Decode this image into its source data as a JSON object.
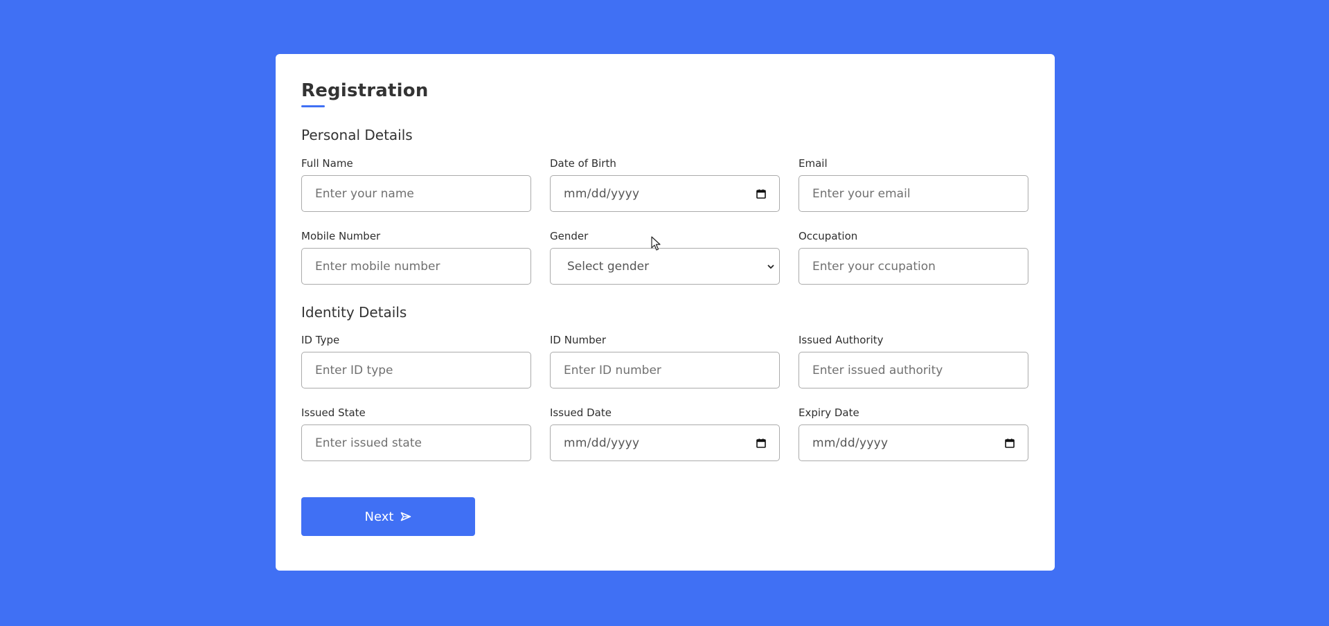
{
  "form": {
    "title": "Registration",
    "next_label": "Next"
  },
  "sections": {
    "personal": {
      "title": "Personal Details",
      "full_name": {
        "label": "Full Name",
        "placeholder": "Enter your name"
      },
      "dob": {
        "label": "Date of Birth",
        "value": "mm/dd/yyyy"
      },
      "email": {
        "label": "Email",
        "placeholder": "Enter your email"
      },
      "mobile": {
        "label": "Mobile Number",
        "placeholder": "Enter mobile number"
      },
      "gender": {
        "label": "Gender",
        "selected": "Select gender"
      },
      "occupation": {
        "label": "Occupation",
        "placeholder": "Enter your ccupation"
      }
    },
    "identity": {
      "title": "Identity Details",
      "id_type": {
        "label": "ID Type",
        "placeholder": "Enter ID type"
      },
      "id_number": {
        "label": "ID Number",
        "placeholder": "Enter ID number"
      },
      "issued_authority": {
        "label": "Issued Authority",
        "placeholder": "Enter issued authority"
      },
      "issued_state": {
        "label": "Issued State",
        "placeholder": "Enter issued state"
      },
      "issued_date": {
        "label": "Issued Date",
        "value": "mm/dd/yyyy"
      },
      "expiry_date": {
        "label": "Expiry Date",
        "value": "mm/dd/yyyy"
      }
    }
  },
  "icons": {
    "calendar": "calendar-icon",
    "chevron": "chevron-down-icon",
    "send": "send-icon",
    "cursor": "mouse-cursor-icon"
  },
  "colors": {
    "background": "#4070f4",
    "accent": "#4070f4",
    "card": "#ffffff",
    "text": "#333333"
  }
}
